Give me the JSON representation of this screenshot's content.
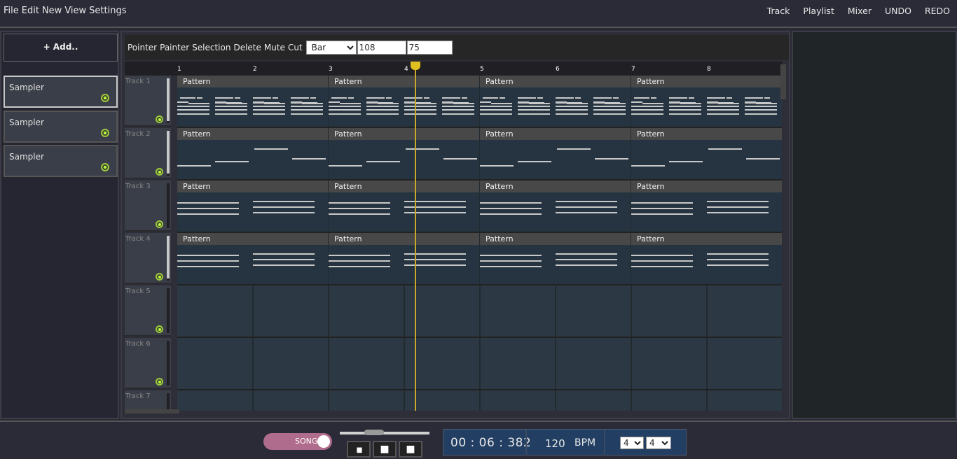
{
  "menu": {
    "left": [
      "File",
      "Edit",
      "New",
      "View",
      "Settings"
    ],
    "right": [
      "Track",
      "Playlist",
      "Mixer",
      "UNDO",
      "REDO"
    ]
  },
  "left_panel": {
    "add_label": "+ Add..",
    "samplers": [
      {
        "label": "Sampler",
        "active": true
      },
      {
        "label": "Sampler",
        "active": false
      },
      {
        "label": "Sampler",
        "active": false
      }
    ]
  },
  "toolbar": {
    "tools": [
      "Pointer",
      "Painter",
      "Selection",
      "Delete",
      "Mute",
      "Cut"
    ],
    "snap_value": "Bar",
    "field1_value": "108",
    "field2_value": "75"
  },
  "ruler": {
    "bars": [
      "1",
      "2",
      "3",
      "4",
      "5",
      "6",
      "7",
      "8"
    ]
  },
  "tracks": [
    {
      "name": "Track 1",
      "volume": 0.95,
      "pattern_label": "Pattern",
      "kind": "melody"
    },
    {
      "name": "Track 2",
      "volume": 0.95,
      "pattern_label": "Pattern",
      "kind": "bass"
    },
    {
      "name": "Track 3",
      "volume": 0.0,
      "pattern_label": "Pattern",
      "kind": "chords"
    },
    {
      "name": "Track 4",
      "volume": 0.95,
      "pattern_label": "Pattern",
      "kind": "chords"
    },
    {
      "name": "Track 5",
      "volume": 0.0,
      "kind": "empty"
    },
    {
      "name": "Track 6",
      "volume": 0.0,
      "kind": "empty"
    },
    {
      "name": "Track 7",
      "volume": 0.0,
      "kind": "empty"
    }
  ],
  "transport": {
    "song_label": "SONG",
    "time": "00 : 06 : 382",
    "bpm_value": "120",
    "bpm_label": "BPM",
    "ts_numerator": "4",
    "ts_denominator": "4",
    "pause_glyph": "▮▮",
    "stop_glyph": "■",
    "record_glyph": "■"
  }
}
